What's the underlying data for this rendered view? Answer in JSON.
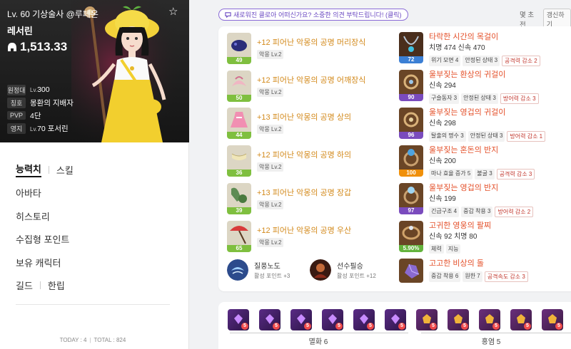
{
  "profile": {
    "level_line": "Lv. 60 기상술사 @루페온",
    "name": "레서린",
    "combat_power": "1,513.33",
    "rows": [
      {
        "tag": "원정대",
        "prefix": "Lv.",
        "value": "300"
      },
      {
        "tag": "칭호",
        "prefix": "",
        "value": "몽환의 지배자"
      },
      {
        "tag": "PVP",
        "prefix": "",
        "value": "4단"
      },
      {
        "tag": "영지",
        "prefix": "Lv.",
        "value": "70 포서린"
      }
    ]
  },
  "menu": {
    "tab_stats": "능력치",
    "tab_skills": "스킬",
    "avatar": "아바타",
    "history": "히스토리",
    "collectibles": "수집형 포인트",
    "characters": "보유 캐릭터",
    "guild": "길드",
    "guild_name": "한립"
  },
  "footer": {
    "today": "TODAY : 4",
    "total": "TOTAL : 824"
  },
  "notice": {
    "text": "새로워진 클로아 어떠신가요? 소중한 의견 부탁드립니다! (클릭)"
  },
  "topright": {
    "text": "몇 초 전",
    "refresh": "갱신하기"
  },
  "armor": [
    {
      "quality": "49",
      "name": "+12 피어난 악몽의 공명 머리장식",
      "sub": "악몽 Lv.2",
      "qclass": "q-green"
    },
    {
      "quality": "50",
      "name": "+12 피어난 악몽의 공명 어깨장식",
      "sub": "악몽 Lv.2",
      "qclass": "q-green"
    },
    {
      "quality": "44",
      "name": "+13 피어난 악몽의 공명 상의",
      "sub": "악몽 Lv.2",
      "qclass": "q-green"
    },
    {
      "quality": "36",
      "name": "+12 피어난 악몽의 공명 하의",
      "sub": "악몽 Lv.2",
      "qclass": "q-green"
    },
    {
      "quality": "39",
      "name": "+13 피어난 악몽의 공명 장갑",
      "sub": "악몽 Lv.2",
      "qclass": "q-green"
    },
    {
      "quality": "65",
      "name": "+12 피어난 악몽의 공명 우산",
      "sub": "악몽 Lv.2",
      "qclass": "q-green"
    }
  ],
  "accessories": [
    {
      "quality": "72",
      "name": "타락한 시간의 목걸이",
      "stats": "치명 474  신속 470",
      "tags": [
        {
          "t": "위기 모면 4",
          "red": false
        },
        {
          "t": "안정된 상태 3",
          "red": false
        },
        {
          "t": "공격력 감소 2",
          "red": true
        }
      ]
    },
    {
      "quality": "90",
      "name": "울부짖는 환상의 귀걸이",
      "stats": "신속 294",
      "tags": [
        {
          "t": "구슬동자 3",
          "red": false
        },
        {
          "t": "안정된 상태 3",
          "red": false
        },
        {
          "t": "방어력 감소 3",
          "red": true
        }
      ]
    },
    {
      "quality": "96",
      "name": "울부짖는 영겁의 귀걸이",
      "stats": "신속 298",
      "tags": [
        {
          "t": "탈출의 명수 3",
          "red": false
        },
        {
          "t": "안정된 상태 3",
          "red": false
        },
        {
          "t": "방어력 감소 1",
          "red": true
        }
      ]
    },
    {
      "quality": "100",
      "name": "울부짖는 혼돈의 반지",
      "stats": "신속 200",
      "tags": [
        {
          "t": "마나 효율 증가 5",
          "red": false
        },
        {
          "t": "불굴 3",
          "red": false
        },
        {
          "t": "공격력 감소 3",
          "red": true
        }
      ]
    },
    {
      "quality": "97",
      "name": "울부짖는 영겁의 반지",
      "stats": "신속 199",
      "tags": [
        {
          "t": "긴급구조 4",
          "red": false
        },
        {
          "t": "중갑 착용 3",
          "red": false
        },
        {
          "t": "방어력 감소 2",
          "red": true
        }
      ]
    },
    {
      "quality": "5.90%",
      "name": "고귀한 영웅의 팔찌",
      "stats": "신속 92  치명 80",
      "tags": [
        {
          "t": "체력",
          "red": false
        },
        {
          "t": "지능",
          "red": false
        }
      ]
    },
    {
      "quality": "",
      "name": "고고한 비상의 돌",
      "stats": "",
      "tags": [
        {
          "t": "중갑 착용 6",
          "red": false
        },
        {
          "t": "원한 7",
          "red": false
        },
        {
          "t": "공격속도 감소 3",
          "red": true
        }
      ]
    }
  ],
  "skills": [
    {
      "name": "질풍노도",
      "sub": "활성 포인트 +3"
    },
    {
      "name": "선수필승",
      "sub": "활성 포인트 +12"
    }
  ],
  "gems": {
    "badge": "5",
    "groups": [
      {
        "label": "멸화 6"
      },
      {
        "label": "홍염 5"
      }
    ]
  }
}
